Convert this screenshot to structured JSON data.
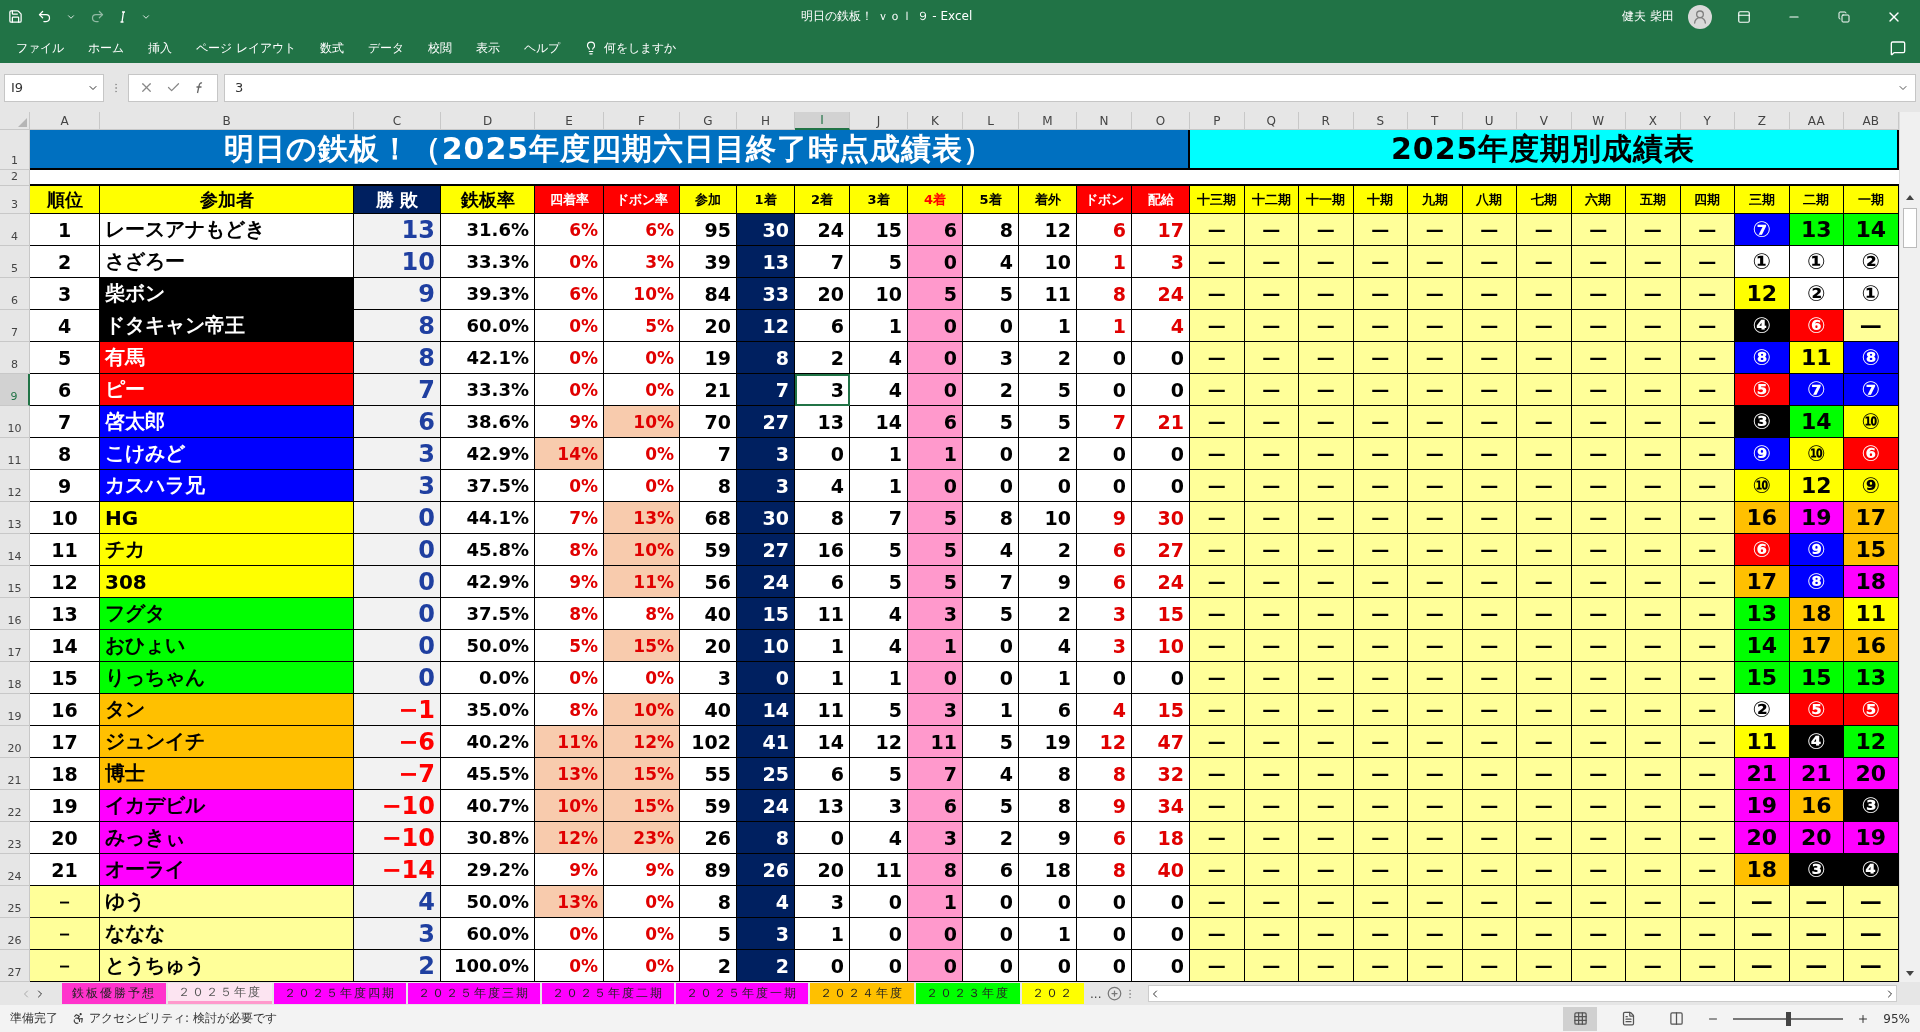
{
  "window": {
    "title": "明日の鉄板！ ｖｏｌ ９ - Excel",
    "user": "健夫 柴田"
  },
  "ribbon": {
    "tabs": [
      "ファイル",
      "ホーム",
      "挿入",
      "ページ レイアウト",
      "数式",
      "データ",
      "校閲",
      "表示",
      "ヘルプ"
    ],
    "tell_me": "何をしますか"
  },
  "formula_bar": {
    "name_box": "I9",
    "formula": "3"
  },
  "column_headers": [
    {
      "label": "A",
      "selected": false
    },
    {
      "label": "B",
      "selected": false
    },
    {
      "label": "C",
      "selected": false
    },
    {
      "label": "D",
      "selected": false
    },
    {
      "label": "E",
      "selected": false
    },
    {
      "label": "F",
      "selected": false
    },
    {
      "label": "G",
      "selected": false
    },
    {
      "label": "H",
      "selected": false
    },
    {
      "label": "I",
      "selected": true
    },
    {
      "label": "J",
      "selected": false
    },
    {
      "label": "K",
      "selected": false
    },
    {
      "label": "L",
      "selected": false
    },
    {
      "label": "M",
      "selected": false
    },
    {
      "label": "N",
      "selected": false
    },
    {
      "label": "O",
      "selected": false
    },
    {
      "label": "P",
      "selected": false
    },
    {
      "label": "Q",
      "selected": false
    },
    {
      "label": "R",
      "selected": false
    },
    {
      "label": "S",
      "selected": false
    },
    {
      "label": "T",
      "selected": false
    },
    {
      "label": "U",
      "selected": false
    },
    {
      "label": "V",
      "selected": false
    },
    {
      "label": "W",
      "selected": false
    },
    {
      "label": "X",
      "selected": false
    },
    {
      "label": "Y",
      "selected": false
    },
    {
      "label": "Z",
      "selected": false
    },
    {
      "label": "AA",
      "selected": false
    },
    {
      "label": "AB",
      "selected": false
    }
  ],
  "row_headers": [
    {
      "label": "1",
      "selected": false
    },
    {
      "label": "2",
      "selected": false
    },
    {
      "label": "3",
      "selected": false
    },
    {
      "label": "4",
      "selected": false
    },
    {
      "label": "5",
      "selected": false
    },
    {
      "label": "6",
      "selected": false
    },
    {
      "label": "7",
      "selected": false
    },
    {
      "label": "8",
      "selected": false
    },
    {
      "label": "9",
      "selected": true
    },
    {
      "label": "10",
      "selected": false
    },
    {
      "label": "11",
      "selected": false
    },
    {
      "label": "12",
      "selected": false
    },
    {
      "label": "13",
      "selected": false
    },
    {
      "label": "14",
      "selected": false
    },
    {
      "label": "15",
      "selected": false
    },
    {
      "label": "16",
      "selected": false
    },
    {
      "label": "17",
      "selected": false
    },
    {
      "label": "18",
      "selected": false
    },
    {
      "label": "19",
      "selected": false
    },
    {
      "label": "20",
      "selected": false
    },
    {
      "label": "21",
      "selected": false
    },
    {
      "label": "22",
      "selected": false
    },
    {
      "label": "23",
      "selected": false
    },
    {
      "label": "24",
      "selected": false
    },
    {
      "label": "25",
      "selected": false
    },
    {
      "label": "26",
      "selected": false
    },
    {
      "label": "27",
      "selected": false
    }
  ],
  "title_left": "明日の鉄板！（2025年度四期六日目終了時点成績表）",
  "title_right": "2025年度期別成績表",
  "headers": [
    {
      "text": "順位",
      "kind": "plain"
    },
    {
      "text": "参加者",
      "kind": "plain"
    },
    {
      "text": "勝 敗",
      "kind": "dark"
    },
    {
      "text": "鉄板率",
      "kind": "plain"
    },
    {
      "text": "四着率",
      "kind": "red"
    },
    {
      "text": "ドボン率",
      "kind": "red"
    },
    {
      "text": "参加",
      "kind": "plain"
    },
    {
      "text": "1着",
      "kind": "plain"
    },
    {
      "text": "2着",
      "kind": "plain"
    },
    {
      "text": "3着",
      "kind": "plain"
    },
    {
      "text": "4着",
      "kind": "redtext"
    },
    {
      "text": "5着",
      "kind": "plain"
    },
    {
      "text": "着外",
      "kind": "plain"
    },
    {
      "text": "ドボン",
      "kind": "red"
    },
    {
      "text": "配給",
      "kind": "red"
    }
  ],
  "period_headers": [
    "十三期",
    "十二期",
    "十一期",
    "十期",
    "九期",
    "八期",
    "七期",
    "六期",
    "五期",
    "四期",
    "三期",
    "二期",
    "一期"
  ],
  "rows": [
    {
      "kind": "ranked",
      "rank": "1",
      "name": "レースアナもどき",
      "color": "#ffffff",
      "score": "13",
      "score_negative": false,
      "rate": "31.6%",
      "r4": "6%",
      "r4_high": false,
      "dobon_rate": "6%",
      "dobon_high": false,
      "stats": [
        "95",
        "30",
        "24",
        "15",
        "6",
        "8",
        "12",
        "6",
        "17"
      ],
      "old": [
        "—",
        "—",
        "—",
        "—",
        "—",
        "—",
        "—",
        "—",
        "—",
        "—"
      ],
      "recent": [
        {
          "text": "⑦",
          "color": "#0000ff"
        },
        {
          "text": "13",
          "color": "#00ff00"
        },
        {
          "text": "14",
          "color": "#00ff00"
        }
      ],
      "selected": false
    },
    {
      "kind": "ranked",
      "rank": "2",
      "name": "さざろー",
      "color": "#ffffff",
      "score": "10",
      "score_negative": false,
      "rate": "33.3%",
      "r4": "0%",
      "r4_high": false,
      "dobon_rate": "3%",
      "dobon_high": false,
      "stats": [
        "39",
        "13",
        "7",
        "5",
        "0",
        "4",
        "10",
        "1",
        "3"
      ],
      "old": [
        "—",
        "—",
        "—",
        "—",
        "—",
        "—",
        "—",
        "—",
        "—",
        "—"
      ],
      "recent": [
        {
          "text": "①",
          "color": "#ffffff"
        },
        {
          "text": "①",
          "color": "#ffffff"
        },
        {
          "text": "②",
          "color": "#ffffff"
        }
      ],
      "selected": false
    },
    {
      "kind": "ranked",
      "rank": "3",
      "name": "柴ボン",
      "color": "#000000",
      "score": "9",
      "score_negative": false,
      "rate": "39.3%",
      "r4": "6%",
      "r4_high": false,
      "dobon_rate": "10%",
      "dobon_high": false,
      "stats": [
        "84",
        "33",
        "20",
        "10",
        "5",
        "5",
        "11",
        "8",
        "24"
      ],
      "old": [
        "—",
        "—",
        "—",
        "—",
        "—",
        "—",
        "—",
        "—",
        "—",
        "—"
      ],
      "recent": [
        {
          "text": "12",
          "color": "#ffff00"
        },
        {
          "text": "②",
          "color": "#ffffff"
        },
        {
          "text": "①",
          "color": "#ffffff"
        }
      ],
      "selected": false
    },
    {
      "kind": "ranked",
      "rank": "4",
      "name": "ドタキャン帝王",
      "color": "#000000",
      "score": "8",
      "score_negative": false,
      "rate": "60.0%",
      "r4": "0%",
      "r4_high": false,
      "dobon_rate": "5%",
      "dobon_high": false,
      "stats": [
        "20",
        "12",
        "6",
        "1",
        "0",
        "0",
        "1",
        "1",
        "4"
      ],
      "old": [
        "—",
        "—",
        "—",
        "—",
        "—",
        "—",
        "—",
        "—",
        "—",
        "—"
      ],
      "recent": [
        {
          "text": "④",
          "color": "#000000"
        },
        {
          "text": "⑥",
          "color": "#ff0000"
        },
        {
          "text": "—",
          "color": "#ffff99"
        }
      ],
      "selected": false
    },
    {
      "kind": "ranked",
      "rank": "5",
      "name": "有馬",
      "color": "#ff0000",
      "score": "8",
      "score_negative": false,
      "rate": "42.1%",
      "r4": "0%",
      "r4_high": false,
      "dobon_rate": "0%",
      "dobon_high": false,
      "stats": [
        "19",
        "8",
        "2",
        "4",
        "0",
        "3",
        "2",
        "0",
        "0"
      ],
      "old": [
        "—",
        "—",
        "—",
        "—",
        "—",
        "—",
        "—",
        "—",
        "—",
        "—"
      ],
      "recent": [
        {
          "text": "⑧",
          "color": "#0000ff"
        },
        {
          "text": "11",
          "color": "#ffff00"
        },
        {
          "text": "⑧",
          "color": "#0000ff"
        }
      ],
      "selected": false
    },
    {
      "kind": "ranked",
      "rank": "6",
      "name": "ピー",
      "color": "#ff0000",
      "score": "7",
      "score_negative": false,
      "rate": "33.3%",
      "r4": "0%",
      "r4_high": false,
      "dobon_rate": "0%",
      "dobon_high": false,
      "stats": [
        "21",
        "7",
        "3",
        "4",
        "0",
        "2",
        "5",
        "0",
        "0"
      ],
      "old": [
        "—",
        "—",
        "—",
        "—",
        "—",
        "—",
        "—",
        "—",
        "—",
        "—"
      ],
      "recent": [
        {
          "text": "⑤",
          "color": "#ff0000"
        },
        {
          "text": "⑦",
          "color": "#0000ff"
        },
        {
          "text": "⑦",
          "color": "#0000ff"
        }
      ],
      "selected": true
    },
    {
      "kind": "ranked",
      "rank": "7",
      "name": "啓太郎",
      "color": "#0000ff",
      "score": "6",
      "score_negative": false,
      "rate": "38.6%",
      "r4": "9%",
      "r4_high": false,
      "dobon_rate": "10%",
      "dobon_high": true,
      "stats": [
        "70",
        "27",
        "13",
        "14",
        "6",
        "5",
        "5",
        "7",
        "21"
      ],
      "old": [
        "—",
        "—",
        "—",
        "—",
        "—",
        "—",
        "—",
        "—",
        "—",
        "—"
      ],
      "recent": [
        {
          "text": "③",
          "color": "#000000"
        },
        {
          "text": "14",
          "color": "#00ff00"
        },
        {
          "text": "⑩",
          "color": "#ffff00"
        }
      ],
      "selected": false
    },
    {
      "kind": "ranked",
      "rank": "8",
      "name": "こけみど",
      "color": "#0000ff",
      "score": "3",
      "score_negative": false,
      "rate": "42.9%",
      "r4": "14%",
      "r4_high": true,
      "dobon_rate": "0%",
      "dobon_high": false,
      "stats": [
        "7",
        "3",
        "0",
        "1",
        "1",
        "0",
        "2",
        "0",
        "0"
      ],
      "old": [
        "—",
        "—",
        "—",
        "—",
        "—",
        "—",
        "—",
        "—",
        "—",
        "—"
      ],
      "recent": [
        {
          "text": "⑨",
          "color": "#0000ff"
        },
        {
          "text": "⑩",
          "color": "#ffff00"
        },
        {
          "text": "⑥",
          "color": "#ff0000"
        }
      ],
      "selected": false
    },
    {
      "kind": "ranked",
      "rank": "9",
      "name": "カスハラ兄",
      "color": "#0000ff",
      "score": "3",
      "score_negative": false,
      "rate": "37.5%",
      "r4": "0%",
      "r4_high": false,
      "dobon_rate": "0%",
      "dobon_high": false,
      "stats": [
        "8",
        "3",
        "4",
        "1",
        "0",
        "0",
        "0",
        "0",
        "0"
      ],
      "old": [
        "—",
        "—",
        "—",
        "—",
        "—",
        "—",
        "—",
        "—",
        "—",
        "—"
      ],
      "recent": [
        {
          "text": "⑩",
          "color": "#ffff00"
        },
        {
          "text": "12",
          "color": "#ffff00"
        },
        {
          "text": "⑨",
          "color": "#ffff00"
        }
      ],
      "selected": false
    },
    {
      "kind": "ranked",
      "rank": "10",
      "name": "HG",
      "color": "#ffff00",
      "score": "0",
      "score_negative": false,
      "rate": "44.1%",
      "r4": "7%",
      "r4_high": false,
      "dobon_rate": "13%",
      "dobon_high": true,
      "stats": [
        "68",
        "30",
        "8",
        "7",
        "5",
        "8",
        "10",
        "9",
        "30"
      ],
      "old": [
        "—",
        "—",
        "—",
        "—",
        "—",
        "—",
        "—",
        "—",
        "—",
        "—"
      ],
      "recent": [
        {
          "text": "16",
          "color": "#ffc000"
        },
        {
          "text": "19",
          "color": "#ff00ff"
        },
        {
          "text": "17",
          "color": "#ffc000"
        }
      ],
      "selected": false
    },
    {
      "kind": "ranked",
      "rank": "11",
      "name": "チカ",
      "color": "#ffff00",
      "score": "0",
      "score_negative": false,
      "rate": "45.8%",
      "r4": "8%",
      "r4_high": false,
      "dobon_rate": "10%",
      "dobon_high": true,
      "stats": [
        "59",
        "27",
        "16",
        "5",
        "5",
        "4",
        "2",
        "6",
        "27"
      ],
      "old": [
        "—",
        "—",
        "—",
        "—",
        "—",
        "—",
        "—",
        "—",
        "—",
        "—"
      ],
      "recent": [
        {
          "text": "⑥",
          "color": "#ff0000"
        },
        {
          "text": "⑨",
          "color": "#0000ff"
        },
        {
          "text": "15",
          "color": "#ffc000"
        }
      ],
      "selected": false
    },
    {
      "kind": "ranked",
      "rank": "12",
      "name": "308",
      "color": "#ffff00",
      "score": "0",
      "score_negative": false,
      "rate": "42.9%",
      "r4": "9%",
      "r4_high": false,
      "dobon_rate": "11%",
      "dobon_high": true,
      "stats": [
        "56",
        "24",
        "6",
        "5",
        "5",
        "7",
        "9",
        "6",
        "24"
      ],
      "old": [
        "—",
        "—",
        "—",
        "—",
        "—",
        "—",
        "—",
        "—",
        "—",
        "—"
      ],
      "recent": [
        {
          "text": "17",
          "color": "#ffc000"
        },
        {
          "text": "⑧",
          "color": "#0000ff"
        },
        {
          "text": "18",
          "color": "#ff00ff"
        }
      ],
      "selected": false
    },
    {
      "kind": "ranked",
      "rank": "13",
      "name": "フグタ",
      "color": "#00ff00",
      "score": "0",
      "score_negative": false,
      "rate": "37.5%",
      "r4": "8%",
      "r4_high": false,
      "dobon_rate": "8%",
      "dobon_high": false,
      "stats": [
        "40",
        "15",
        "11",
        "4",
        "3",
        "5",
        "2",
        "3",
        "15"
      ],
      "old": [
        "—",
        "—",
        "—",
        "—",
        "—",
        "—",
        "—",
        "—",
        "—",
        "—"
      ],
      "recent": [
        {
          "text": "13",
          "color": "#00ff00"
        },
        {
          "text": "18",
          "color": "#ffc000"
        },
        {
          "text": "11",
          "color": "#ffff00"
        }
      ],
      "selected": false
    },
    {
      "kind": "ranked",
      "rank": "14",
      "name": "おひょい",
      "color": "#00ff00",
      "score": "0",
      "score_negative": false,
      "rate": "50.0%",
      "r4": "5%",
      "r4_high": false,
      "dobon_rate": "15%",
      "dobon_high": true,
      "stats": [
        "20",
        "10",
        "1",
        "4",
        "1",
        "0",
        "4",
        "3",
        "10"
      ],
      "old": [
        "—",
        "—",
        "—",
        "—",
        "—",
        "—",
        "—",
        "—",
        "—",
        "—"
      ],
      "recent": [
        {
          "text": "14",
          "color": "#00ff00"
        },
        {
          "text": "17",
          "color": "#ffc000"
        },
        {
          "text": "16",
          "color": "#ffc000"
        }
      ],
      "selected": false
    },
    {
      "kind": "ranked",
      "rank": "15",
      "name": "りっちゃん",
      "color": "#00ff00",
      "score": "0",
      "score_negative": false,
      "rate": "0.0%",
      "r4": "0%",
      "r4_high": false,
      "dobon_rate": "0%",
      "dobon_high": false,
      "stats": [
        "3",
        "0",
        "1",
        "1",
        "0",
        "0",
        "1",
        "0",
        "0"
      ],
      "old": [
        "—",
        "—",
        "—",
        "—",
        "—",
        "—",
        "—",
        "—",
        "—",
        "—"
      ],
      "recent": [
        {
          "text": "15",
          "color": "#00ff00"
        },
        {
          "text": "15",
          "color": "#00ff00"
        },
        {
          "text": "13",
          "color": "#00ff00"
        }
      ],
      "selected": false
    },
    {
      "kind": "ranked",
      "rank": "16",
      "name": "タン",
      "color": "#ffc000",
      "score": "−1",
      "score_negative": true,
      "rate": "35.0%",
      "r4": "8%",
      "r4_high": false,
      "dobon_rate": "10%",
      "dobon_high": true,
      "stats": [
        "40",
        "14",
        "11",
        "5",
        "3",
        "1",
        "6",
        "4",
        "15"
      ],
      "old": [
        "—",
        "—",
        "—",
        "—",
        "—",
        "—",
        "—",
        "—",
        "—",
        "—"
      ],
      "recent": [
        {
          "text": "②",
          "color": "#ffffff"
        },
        {
          "text": "⑤",
          "color": "#ff0000"
        },
        {
          "text": "⑤",
          "color": "#ff0000"
        }
      ],
      "selected": false
    },
    {
      "kind": "ranked",
      "rank": "17",
      "name": "ジュンイチ",
      "color": "#ffc000",
      "score": "−6",
      "score_negative": true,
      "rate": "40.2%",
      "r4": "11%",
      "r4_high": true,
      "dobon_rate": "12%",
      "dobon_high": true,
      "stats": [
        "102",
        "41",
        "14",
        "12",
        "11",
        "5",
        "19",
        "12",
        "47"
      ],
      "old": [
        "—",
        "—",
        "—",
        "—",
        "—",
        "—",
        "—",
        "—",
        "—",
        "—"
      ],
      "recent": [
        {
          "text": "11",
          "color": "#ffff00"
        },
        {
          "text": "④",
          "color": "#000000"
        },
        {
          "text": "12",
          "color": "#00ff00"
        }
      ],
      "selected": false
    },
    {
      "kind": "ranked",
      "rank": "18",
      "name": "博士",
      "color": "#ffc000",
      "score": "−7",
      "score_negative": true,
      "rate": "45.5%",
      "r4": "13%",
      "r4_high": true,
      "dobon_rate": "15%",
      "dobon_high": true,
      "stats": [
        "55",
        "25",
        "6",
        "5",
        "7",
        "4",
        "8",
        "8",
        "32"
      ],
      "old": [
        "—",
        "—",
        "—",
        "—",
        "—",
        "—",
        "—",
        "—",
        "—",
        "—"
      ],
      "recent": [
        {
          "text": "21",
          "color": "#ff00ff"
        },
        {
          "text": "21",
          "color": "#ff00ff"
        },
        {
          "text": "20",
          "color": "#ff00ff"
        }
      ],
      "selected": false
    },
    {
      "kind": "ranked",
      "rank": "19",
      "name": "イカデビル",
      "color": "#ff00ff",
      "score": "−10",
      "score_negative": true,
      "rate": "40.7%",
      "r4": "10%",
      "r4_high": true,
      "dobon_rate": "15%",
      "dobon_high": true,
      "stats": [
        "59",
        "24",
        "13",
        "3",
        "6",
        "5",
        "8",
        "9",
        "34"
      ],
      "old": [
        "—",
        "—",
        "—",
        "—",
        "—",
        "—",
        "—",
        "—",
        "—",
        "—"
      ],
      "recent": [
        {
          "text": "19",
          "color": "#ff00ff"
        },
        {
          "text": "16",
          "color": "#ffc000"
        },
        {
          "text": "③",
          "color": "#000000"
        }
      ],
      "selected": false
    },
    {
      "kind": "ranked",
      "rank": "20",
      "name": "みっきぃ",
      "color": "#ff00ff",
      "score": "−10",
      "score_negative": true,
      "rate": "30.8%",
      "r4": "12%",
      "r4_high": true,
      "dobon_rate": "23%",
      "dobon_high": true,
      "stats": [
        "26",
        "8",
        "0",
        "4",
        "3",
        "2",
        "9",
        "6",
        "18"
      ],
      "old": [
        "—",
        "—",
        "—",
        "—",
        "—",
        "—",
        "—",
        "—",
        "—",
        "—"
      ],
      "recent": [
        {
          "text": "20",
          "color": "#ff00ff"
        },
        {
          "text": "20",
          "color": "#ff00ff"
        },
        {
          "text": "19",
          "color": "#ff00ff"
        }
      ],
      "selected": false
    },
    {
      "kind": "ranked",
      "rank": "21",
      "name": "オーライ",
      "color": "#ff00ff",
      "score": "−14",
      "score_negative": true,
      "rate": "29.2%",
      "r4": "9%",
      "r4_high": false,
      "dobon_rate": "9%",
      "dobon_high": false,
      "stats": [
        "89",
        "26",
        "20",
        "11",
        "8",
        "6",
        "18",
        "8",
        "40"
      ],
      "old": [
        "—",
        "—",
        "—",
        "—",
        "—",
        "—",
        "—",
        "—",
        "—",
        "—"
      ],
      "recent": [
        {
          "text": "18",
          "color": "#ffc000"
        },
        {
          "text": "③",
          "color": "#000000"
        },
        {
          "text": "④",
          "color": "#000000"
        }
      ],
      "selected": false
    },
    {
      "kind": "guest",
      "rank": "－",
      "name": "ゆう",
      "color": "#ffff99",
      "score": "4",
      "score_negative": false,
      "rate": "50.0%",
      "r4": "13%",
      "r4_high": true,
      "dobon_rate": "0%",
      "dobon_high": false,
      "stats": [
        "8",
        "4",
        "3",
        "0",
        "1",
        "0",
        "0",
        "0",
        "0"
      ],
      "old": [
        "—",
        "—",
        "—",
        "—",
        "—",
        "—",
        "—",
        "—",
        "—",
        "—"
      ],
      "recent": [
        {
          "text": "—",
          "color": "#ffff99"
        },
        {
          "text": "—",
          "color": "#ffff99"
        },
        {
          "text": "—",
          "color": "#ffff99"
        }
      ],
      "selected": false
    },
    {
      "kind": "guest",
      "rank": "－",
      "name": "ななな",
      "color": "#ffff99",
      "score": "3",
      "score_negative": false,
      "rate": "60.0%",
      "r4": "0%",
      "r4_high": false,
      "dobon_rate": "0%",
      "dobon_high": false,
      "stats": [
        "5",
        "3",
        "1",
        "0",
        "0",
        "0",
        "1",
        "0",
        "0"
      ],
      "old": [
        "—",
        "—",
        "—",
        "—",
        "—",
        "—",
        "—",
        "—",
        "—",
        "—"
      ],
      "recent": [
        {
          "text": "—",
          "color": "#ffff99"
        },
        {
          "text": "—",
          "color": "#ffff99"
        },
        {
          "text": "—",
          "color": "#ffff99"
        }
      ],
      "selected": false
    },
    {
      "kind": "guest",
      "rank": "－",
      "name": "とうちゅう",
      "color": "#ffff99",
      "score": "2",
      "score_negative": false,
      "rate": "100.0%",
      "r4": "0%",
      "r4_high": false,
      "dobon_rate": "0%",
      "dobon_high": false,
      "stats": [
        "2",
        "2",
        "0",
        "0",
        "0",
        "0",
        "0",
        "0",
        "0"
      ],
      "old": [
        "—",
        "—",
        "—",
        "—",
        "—",
        "—",
        "—",
        "—",
        "—",
        "—"
      ],
      "recent": [
        {
          "text": "—",
          "color": "#ffff99"
        },
        {
          "text": "—",
          "color": "#ffff99"
        },
        {
          "text": "—",
          "color": "#ffff99"
        }
      ],
      "selected": false
    }
  ],
  "sheet_tabs": [
    {
      "label": "鉄板優勝予想",
      "color": "#ff33cc",
      "selected": false
    },
    {
      "label": "２０２５年度",
      "color": "#ff99cc",
      "selected": true
    },
    {
      "label": "２０２５年度四期",
      "color": "#ff00ff",
      "selected": false
    },
    {
      "label": "２０２５年度三期",
      "color": "#ff00ff",
      "selected": false
    },
    {
      "label": "２０２５年度二期",
      "color": "#ff00ff",
      "selected": false
    },
    {
      "label": "２０２５年度一期",
      "color": "#ff00ff",
      "selected": false
    },
    {
      "label": "２０２４年度",
      "color": "#ffc000",
      "selected": false
    },
    {
      "label": "２０２３年度",
      "color": "#00ff00",
      "selected": false
    },
    {
      "label": "２０２",
      "color": "#ffff00",
      "selected": false
    }
  ],
  "more_tabs": "...",
  "status_bar": {
    "ready": "準備完了",
    "accessibility": "アクセシビリティ: 検討が必要です",
    "zoom": "95%",
    "zoom_level": {
      "level": 0.5
    }
  }
}
